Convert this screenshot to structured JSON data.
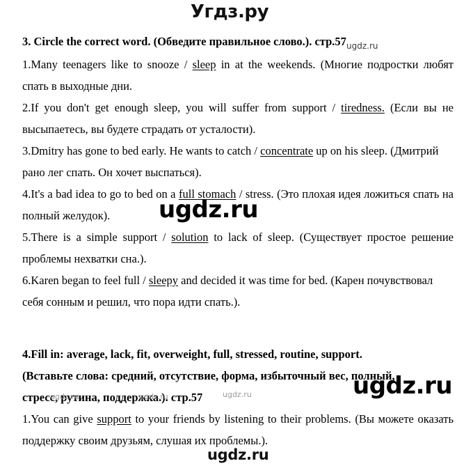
{
  "site": {
    "header_title": "Угдз.ру",
    "watermark_text": "ugdz.ru"
  },
  "watermarks": {
    "header_small": "ugdz.ru",
    "big_middle": "ugdz.ru",
    "big_right": "ugdz.ru",
    "row_1": "ugdz.ru",
    "row_2": "ugdz.ru",
    "row_3": "ugdz.ru",
    "bottom_center": "ugdz.ru"
  },
  "exercise3": {
    "heading": "3. Circle the correct word. (Обведите правильное слово.). стр.57",
    "items": [
      {
        "number": "1.",
        "before": "Many teenagers like to snooze / ",
        "answer": "sleep",
        "after": " in at the weekends. (Многие подростки любят спать в выходные дни.",
        "justified": true
      },
      {
        "number": "2.",
        "before": "If you don't get enough sleep, you will suffer from support / ",
        "answer": "tiredness.",
        "after": " (Если вы не высыпаетесь, вы будете страдать от усталости).",
        "justified": true
      },
      {
        "number": "3.",
        "before": "Dmitry has gone to bed early. He wants to catch / ",
        "answer": "concentrate",
        "after": " up on his sleep. (Дмитрий рано лег спать. Он хочет выспаться).",
        "justified": false
      },
      {
        "number": "4.",
        "before": "It's a bad idea to go to bed on a ",
        "answer": "full stomach",
        "after": " / stress. (Это плохая идея ложиться спать на полный желудок).",
        "justified": true
      },
      {
        "number": "5.",
        "before": "There is a simple support / ",
        "answer": "solution",
        "after": " to lack of sleep. (Существует простое решение проблемы нехватки сна.).",
        "justified": true
      },
      {
        "number": "6.",
        "before": "Karen began to feel full / ",
        "answer": "sleepy",
        "after": " and decided it was time for bed. (Карен почувствовал себя сонным и решил, что пора идти спать.).",
        "justified": false
      }
    ]
  },
  "exercise4": {
    "heading_line1": "4.Fill in: average, lack, fit, overweight, full, stressed, routine, support.",
    "heading_line2": "(Вставьте слова: средний, отсутствие, форма, избыточный вес, полный,",
    "heading_line3": "стресс, рутина, поддержка.). стр.57",
    "items": [
      {
        "number": "1.",
        "before": "You can give ",
        "answer": "support",
        "after": " to your friends by listening to their problems. (Вы можете оказать поддержку своим друзьям, слушая их проблемы.).",
        "justified": true
      }
    ]
  }
}
